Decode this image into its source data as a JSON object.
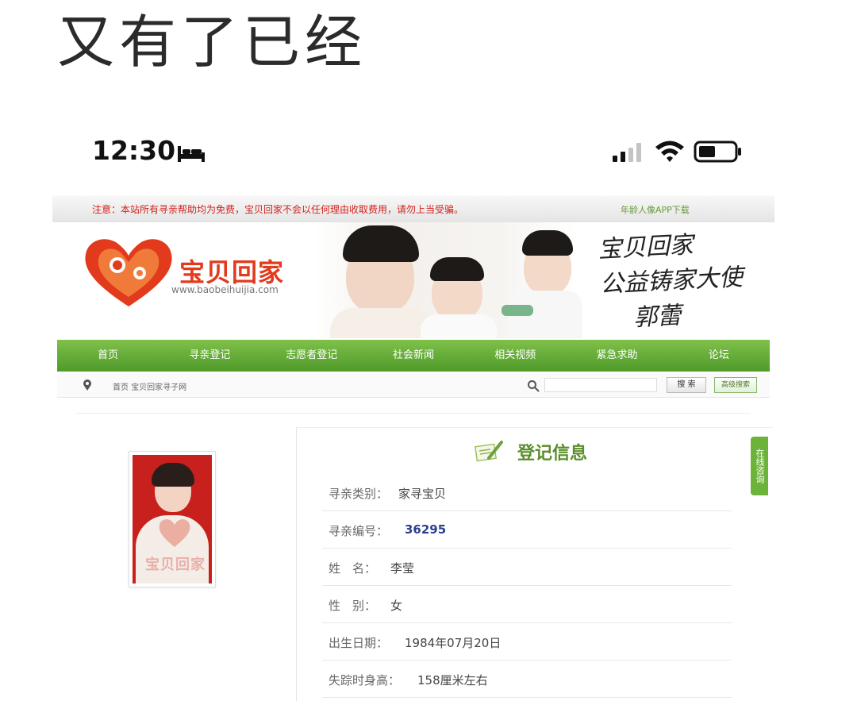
{
  "caption": "又有了已经",
  "status_bar": {
    "time": "12:30",
    "icons": [
      "bed-icon",
      "signal-icon",
      "wifi-icon",
      "battery-icon"
    ]
  },
  "notice": {
    "text": "注意：本站所有寻亲帮助均为免费，宝贝回家不会以任何理由收取费用，请勿上当受骗。",
    "link": "年龄人像APP下载"
  },
  "banner": {
    "logo_text": "宝贝回家",
    "logo_url": "www.baobeihuijia.com",
    "calligraphy": [
      "宝贝回家",
      "公益铸家大使",
      "郭蕾"
    ]
  },
  "nav": {
    "items": [
      "首页",
      "寻亲登记",
      "志愿者登记",
      "社会新闻",
      "相关视频",
      "紧急求助",
      "论坛"
    ]
  },
  "subbar": {
    "breadcrumb": "首页 宝贝回家寻子网",
    "search_button": "搜 索",
    "home_button": "高级搜索"
  },
  "profile": {
    "photo_watermark": "宝贝回家"
  },
  "info": {
    "title": "登记信息",
    "side_tab": "在线咨询",
    "rows": [
      {
        "label": "寻亲类别：",
        "value": "家寻宝贝"
      },
      {
        "label": "寻亲编号：",
        "value": "36295"
      },
      {
        "label": "姓　名：",
        "value": "李莹"
      },
      {
        "label": "性　别：",
        "value": "女"
      },
      {
        "label": "出生日期：",
        "value": "1984年07月20日"
      },
      {
        "label": "失踪时身高：",
        "value": "158厘米左右"
      }
    ]
  },
  "colors": {
    "nav_green": "#5ba532",
    "notice_red": "#d4221c",
    "title_green": "#5a8e2a",
    "id_blue": "#2c3f8f"
  }
}
